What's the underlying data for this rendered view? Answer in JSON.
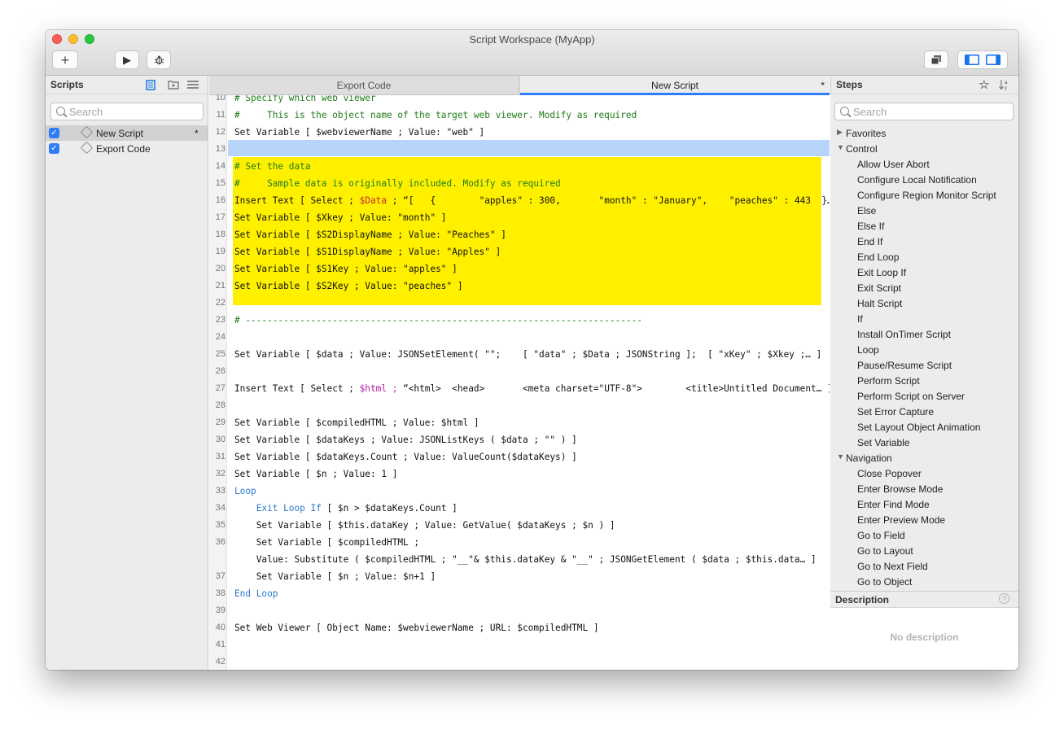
{
  "window": {
    "title": "Script Workspace (MyApp)"
  },
  "toolbar": {
    "add_icon": "+",
    "run_icon": "▶",
    "debug_icon": "bug-icon"
  },
  "scripts_panel": {
    "title": "Scripts",
    "search_placeholder": "Search",
    "items": [
      {
        "name": "New Script",
        "checked": true,
        "modified": "*"
      },
      {
        "name": "Export Code",
        "checked": true,
        "modified": ""
      }
    ]
  },
  "tabs": [
    {
      "label": "Export Code",
      "active": false,
      "modified": ""
    },
    {
      "label": "New Script",
      "active": true,
      "modified": "*"
    }
  ],
  "code_lines": [
    {
      "n": "10",
      "text": "# Specify which web viewer"
    },
    {
      "n": "11",
      "text": "#     This is the object name of the target web viewer. Modify as required"
    },
    {
      "n": "12",
      "text": "Set Variable [ $webviewerName ; Value: \"web\" ]"
    },
    {
      "n": "13",
      "text": ""
    },
    {
      "n": "14",
      "text": "# Set the data"
    },
    {
      "n": "15",
      "text": "#     Sample data is originally included. Modify as required"
    },
    {
      "n": "16",
      "pre": "Insert Text [ Select ; ",
      "var": "$Data",
      "post": " ; “[   {        \"apples\" : 300,       \"month\" : \"January\",    \"peaches\" : 443  }… ]"
    },
    {
      "n": "17",
      "text": "Set Variable [ $Xkey ; Value: \"month\" ]"
    },
    {
      "n": "18",
      "text": "Set Variable [ $S2DisplayName ; Value: \"Peaches\" ]"
    },
    {
      "n": "19",
      "text": "Set Variable [ $S1DisplayName ; Value: \"Apples\" ]"
    },
    {
      "n": "20",
      "text": "Set Variable [ $S1Key ; Value: \"apples\" ]"
    },
    {
      "n": "21",
      "text": "Set Variable [ $S2Key ; Value: \"peaches\" ]"
    },
    {
      "n": "22",
      "text": ""
    },
    {
      "n": "23",
      "text": "# -------------------------------------------------------------------------"
    },
    {
      "n": "24",
      "text": ""
    },
    {
      "n": "25",
      "text": "Set Variable [ $data ; Value: JSONSetElement( \"\";    [ \"data\" ; $Data ; JSONString ];  [ \"xKey\" ; $Xkey ;… ]"
    },
    {
      "n": "26",
      "text": ""
    },
    {
      "n": "27",
      "pre": "Insert Text [ Select ; ",
      "var": "$html ;",
      "post": " “<html>  <head>       <meta charset=\"UTF-8\">        <title>Untitled Document… ]"
    },
    {
      "n": "28",
      "text": ""
    },
    {
      "n": "29",
      "text": "Set Variable [ $compiledHTML ; Value: $html ]"
    },
    {
      "n": "30",
      "text": "Set Variable [ $dataKeys ; Value: JSONListKeys ( $data ; \"\" ) ]"
    },
    {
      "n": "31",
      "text": "Set Variable [ $dataKeys.Count ; Value: ValueCount($dataKeys) ]"
    },
    {
      "n": "32",
      "text": "Set Variable [ $n ; Value: 1 ]"
    },
    {
      "n": "33",
      "text": "Loop"
    },
    {
      "n": "34",
      "kw": "    Exit Loop If",
      "post": " [ $n > $dataKeys.Count ]"
    },
    {
      "n": "35",
      "text": "    Set Variable [ $this.dataKey ; Value: GetValue( $dataKeys ; $n ) ]"
    },
    {
      "n": "36",
      "text": "    Set Variable [ $compiledHTML ;"
    },
    {
      "n": "",
      "text": "    Value: Substitute ( $compiledHTML ; \"__\"& $this.dataKey & \"__\" ; JSONGetElement ( $data ; $this.data… ]"
    },
    {
      "n": "37",
      "text": "    Set Variable [ $n ; Value: $n+1 ]"
    },
    {
      "n": "38",
      "text": "End Loop"
    },
    {
      "n": "39",
      "text": ""
    },
    {
      "n": "40",
      "text": "Set Web Viewer [ Object Name: $webviewerName ; URL: $compiledHTML ]"
    },
    {
      "n": "41",
      "text": ""
    },
    {
      "n": "42",
      "text": ""
    }
  ],
  "steps_panel": {
    "title": "Steps",
    "search_placeholder": "Search",
    "items": [
      {
        "label": "Favorites",
        "group": true,
        "expanded": false
      },
      {
        "label": "Control",
        "group": true,
        "expanded": true
      },
      {
        "label": "Allow User Abort"
      },
      {
        "label": "Configure Local Notification"
      },
      {
        "label": "Configure Region Monitor Script"
      },
      {
        "label": "Else"
      },
      {
        "label": "Else If"
      },
      {
        "label": "End If"
      },
      {
        "label": "End Loop"
      },
      {
        "label": "Exit Loop If"
      },
      {
        "label": "Exit Script"
      },
      {
        "label": "Halt Script"
      },
      {
        "label": "If"
      },
      {
        "label": "Install OnTimer Script"
      },
      {
        "label": "Loop"
      },
      {
        "label": "Pause/Resume Script"
      },
      {
        "label": "Perform Script"
      },
      {
        "label": "Perform Script on Server"
      },
      {
        "label": "Set Error Capture"
      },
      {
        "label": "Set Layout Object Animation"
      },
      {
        "label": "Set Variable"
      },
      {
        "label": "Navigation",
        "group": true,
        "expanded": true
      },
      {
        "label": "Close Popover"
      },
      {
        "label": "Enter Browse Mode"
      },
      {
        "label": "Enter Find Mode"
      },
      {
        "label": "Enter Preview Mode"
      },
      {
        "label": "Go to Field"
      },
      {
        "label": "Go to Layout"
      },
      {
        "label": "Go to Next Field"
      },
      {
        "label": "Go to Object"
      }
    ]
  },
  "description_panel": {
    "title": "Description",
    "help_icon": "?",
    "empty_text": "No description"
  },
  "colors": {
    "selection_highlight": "#fff000",
    "current_line": "#b7d4fb",
    "comment": "#1f7d1a",
    "keyword": "#2b78c8",
    "variable": "#c6272b",
    "accent": "#2f7cf6"
  }
}
